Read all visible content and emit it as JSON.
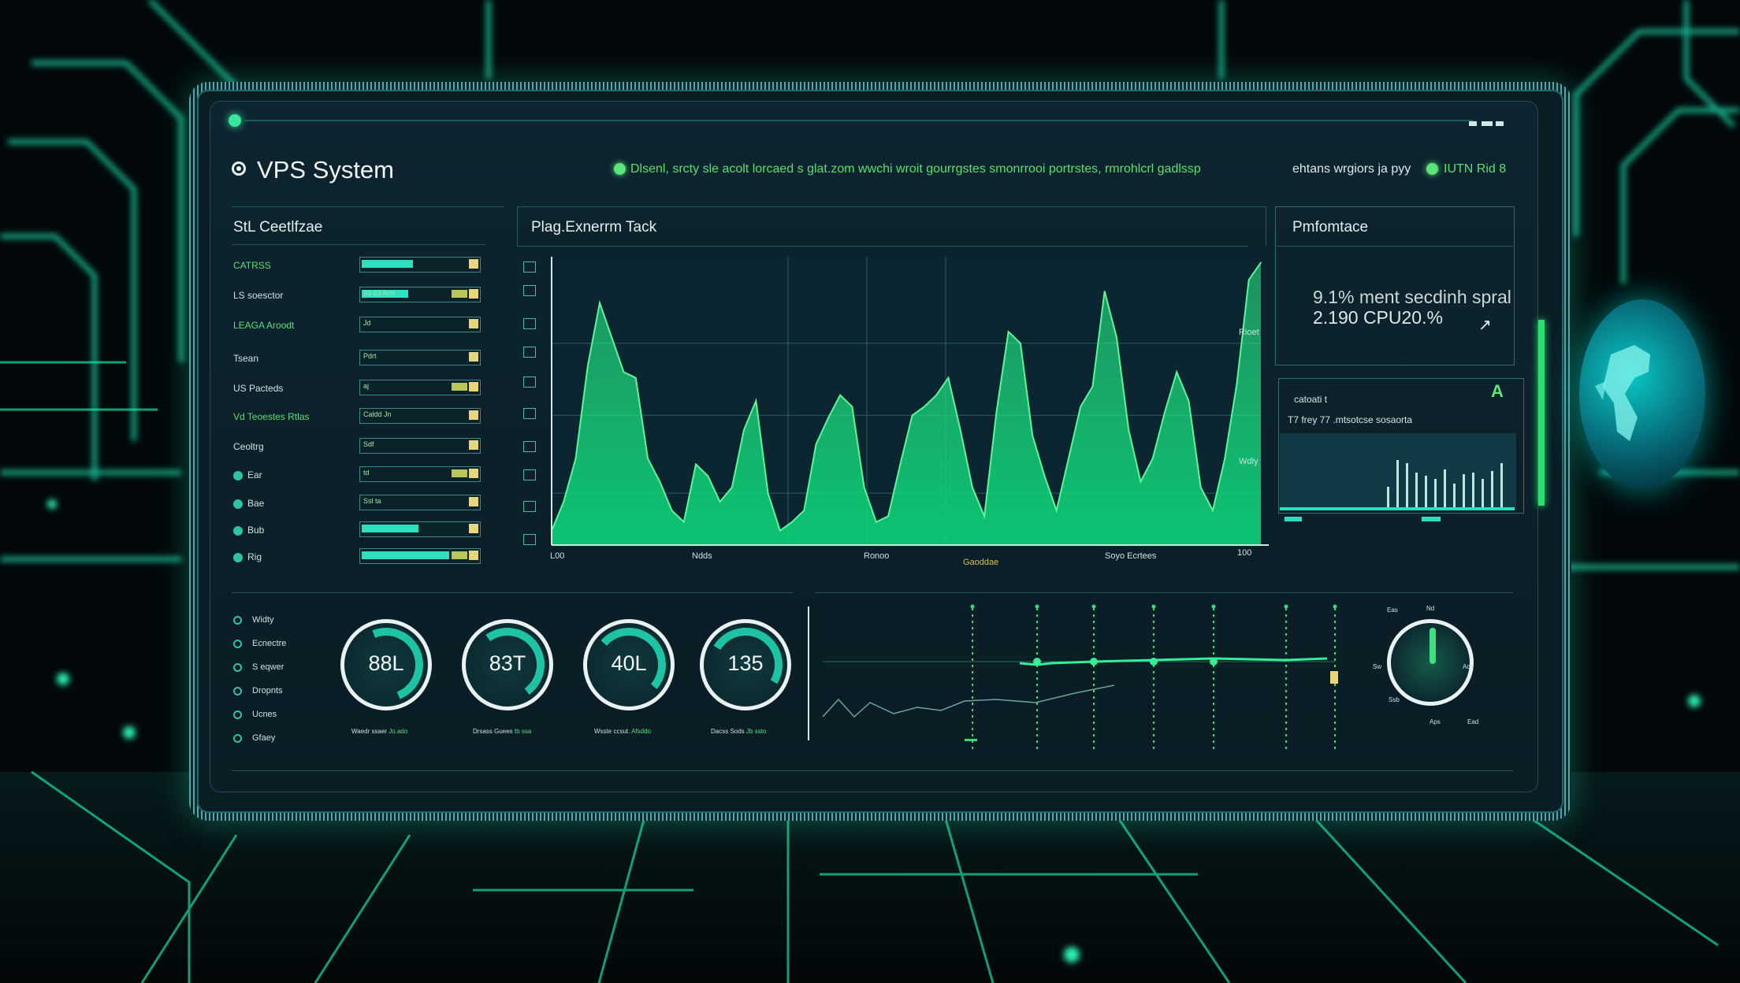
{
  "app": {
    "title": "VPS System",
    "status_message": "Dlsenl, srcty sle acolt lorcaed s glat.zom  wwchi wroit gourrgstes smonrrooi portrstes, rmrohlcrl gadlssp",
    "status_secondary": "ehtans wrgiors ja pyy",
    "status_tertiary": "IUTN Rid 8"
  },
  "left_panel": {
    "title": "StL Ceetlfzae",
    "rows": [
      {
        "label": "CATRSS",
        "tag": "",
        "fill": 0.5,
        "green": true
      },
      {
        "label": "LS  soesctor",
        "tag": "83 83 Acrl",
        "fill": 0.45
      },
      {
        "label": "LEAGA Aroodt",
        "tag": "Jd",
        "fill": 0.0,
        "green": true
      },
      {
        "label": "Tsean",
        "tag": "Pdrt",
        "fill": 0.0
      },
      {
        "label": "US  Pacteds",
        "tag": "aj",
        "fill": 0.0
      },
      {
        "label": "Vd  Teoestes Rtlas",
        "tag": "Caldd Jn",
        "fill": 0.0,
        "green": true
      },
      {
        "label": "Ceoltrg",
        "tag": "Sdf",
        "fill": 0.0
      },
      {
        "label": "Ear",
        "tag": "td",
        "fill": 0.0
      },
      {
        "label": "Bae",
        "tag": "Ssl ta",
        "fill": 0.0
      },
      {
        "label": "Bub",
        "tag": "",
        "fill": 0.55
      },
      {
        "label": "Rig",
        "tag": "",
        "fill": 0.85
      }
    ]
  },
  "main_chart": {
    "title": "Plag.Exnerrm Tack",
    "x_labels": [
      "L00",
      "Ndds",
      "Ronoo",
      "Gaoddae",
      "Soyo Ecrtees",
      "100"
    ],
    "y_labels": [
      "Rioet",
      "Wdly"
    ]
  },
  "chart_data": {
    "type": "area",
    "title": "Plag.Exnerrm Tack",
    "x": [
      0,
      1,
      2,
      3,
      4,
      5,
      6,
      7,
      8,
      9,
      10,
      11,
      12,
      13,
      14,
      15,
      16,
      17,
      18,
      19,
      20,
      21,
      22,
      23,
      24,
      25,
      26,
      27,
      28,
      29,
      30,
      31,
      32,
      33,
      34,
      35,
      36,
      37,
      38,
      39,
      40,
      41,
      42,
      43,
      44,
      45,
      46,
      47,
      48,
      49,
      50,
      51,
      52,
      53,
      54,
      55,
      56,
      57,
      58,
      59
    ],
    "series": [
      {
        "values": [
          5,
          15,
          30,
          62,
          84,
          72,
          60,
          58,
          30,
          22,
          12,
          8,
          28,
          24,
          15,
          20,
          40,
          50,
          18,
          5,
          8,
          12,
          35,
          44,
          52,
          48,
          20,
          8,
          10,
          28,
          45,
          48,
          52,
          58,
          40,
          20,
          10,
          46,
          74,
          70,
          38,
          24,
          12,
          30,
          48,
          55,
          88,
          72,
          40,
          22,
          30,
          46,
          60,
          50,
          20,
          12,
          30,
          56,
          92,
          98
        ]
      }
    ],
    "ylim": [
      0,
      100
    ]
  },
  "performance": {
    "title": "Pmfomtace",
    "line1": "9.1% ment secdinh spral",
    "line2": "2.190 CPU20.%",
    "mini_title": "catoati t",
    "mini_subtitle": "T7 frey 77  .mtsotcse sosaorta",
    "mini_badge": "A"
  },
  "gauges": [
    {
      "value": "88L",
      "caption": "Waedr ssaer",
      "caption_green": "Jo.ado",
      "level": 0.75
    },
    {
      "value": "83T",
      "caption": "Drsass Guees",
      "caption_green": "tb ssa",
      "level": 0.6
    },
    {
      "value": "40L",
      "caption": "Wsste ccsut.",
      "caption_green": "Afsddo",
      "level": 0.45
    },
    {
      "value": "135",
      "caption": "Dacss Sods",
      "caption_green": "Jb ssto",
      "level": 0.35
    }
  ],
  "legend": [
    "Widty",
    "Ecnectre",
    "S eqwer",
    "Dropnts",
    "Ucnes",
    "Gfaey"
  ],
  "knob": {
    "labels": [
      "Eas",
      "Nd",
      "Sw",
      "Ade",
      "Ssb",
      "Aps",
      "Ead"
    ],
    "level": 0.5
  },
  "icons": [
    "power-icon",
    "settings-icon",
    "chart-icon",
    "alert-icon",
    "globe-icon"
  ],
  "colors": {
    "accent": "#38e59a",
    "teal": "#1cc4a4",
    "panel_bg": "#0d2530",
    "yellow": "#e7d77a"
  }
}
